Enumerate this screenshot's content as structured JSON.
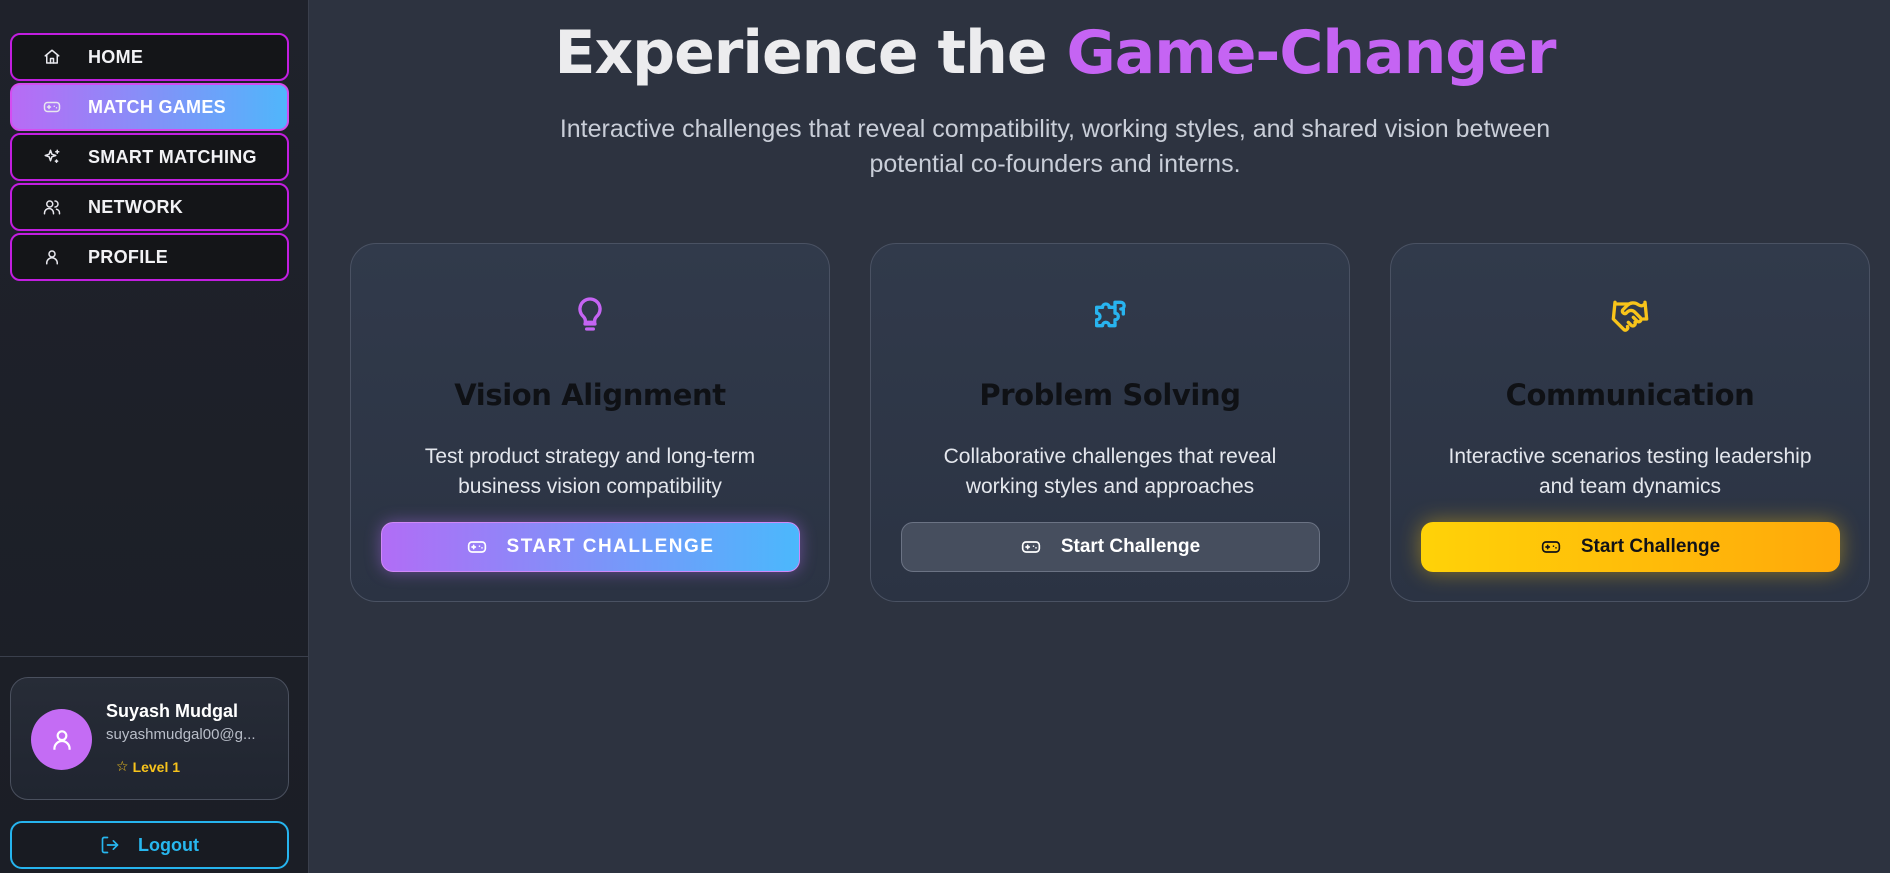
{
  "sidebar": {
    "nav": [
      {
        "label": "HOME",
        "icon": "home-icon",
        "active": false
      },
      {
        "label": "MATCH GAMES",
        "icon": "gamepad-icon",
        "active": true
      },
      {
        "label": "SMART MATCHING",
        "icon": "sparkles-icon",
        "active": false
      },
      {
        "label": "NETWORK",
        "icon": "users-icon",
        "active": false
      },
      {
        "label": "PROFILE",
        "icon": "user-icon",
        "active": false
      }
    ],
    "user": {
      "name": "Suyash Mudgal",
      "email": "suyashmudgal00@g...",
      "level": "Level 1",
      "avatar_icon": "user-icon"
    },
    "logout_label": "Logout"
  },
  "hero": {
    "title_prefix": "Experience the ",
    "title_accent": "Game-Changer",
    "subtitle": "Interactive challenges that reveal compatibility, working styles, and shared vision between potential co-founders and interns."
  },
  "cards": [
    {
      "icon": "lightbulb-icon",
      "icon_color": "#c564f3",
      "title": "Vision Alignment",
      "description": "Test product strategy and long-term business vision compatibility",
      "button_label": "START CHALLENGE",
      "button_style": "gradient"
    },
    {
      "icon": "puzzle-icon",
      "icon_color": "#28b4ef",
      "title": "Problem Solving",
      "description": "Collaborative challenges that reveal working styles and approaches",
      "button_label": "Start Challenge",
      "button_style": "gray"
    },
    {
      "icon": "handshake-icon",
      "icon_color": "#f8c41a",
      "title": "Communication",
      "description": "Interactive scenarios testing leadership and team dynamics",
      "button_label": "Start Challenge",
      "button_style": "yellow"
    }
  ],
  "colors": {
    "accent_purple": "#c564f3",
    "accent_blue": "#28b4ef",
    "accent_yellow": "#f8c41a",
    "nav_border": "#c21ee0"
  }
}
